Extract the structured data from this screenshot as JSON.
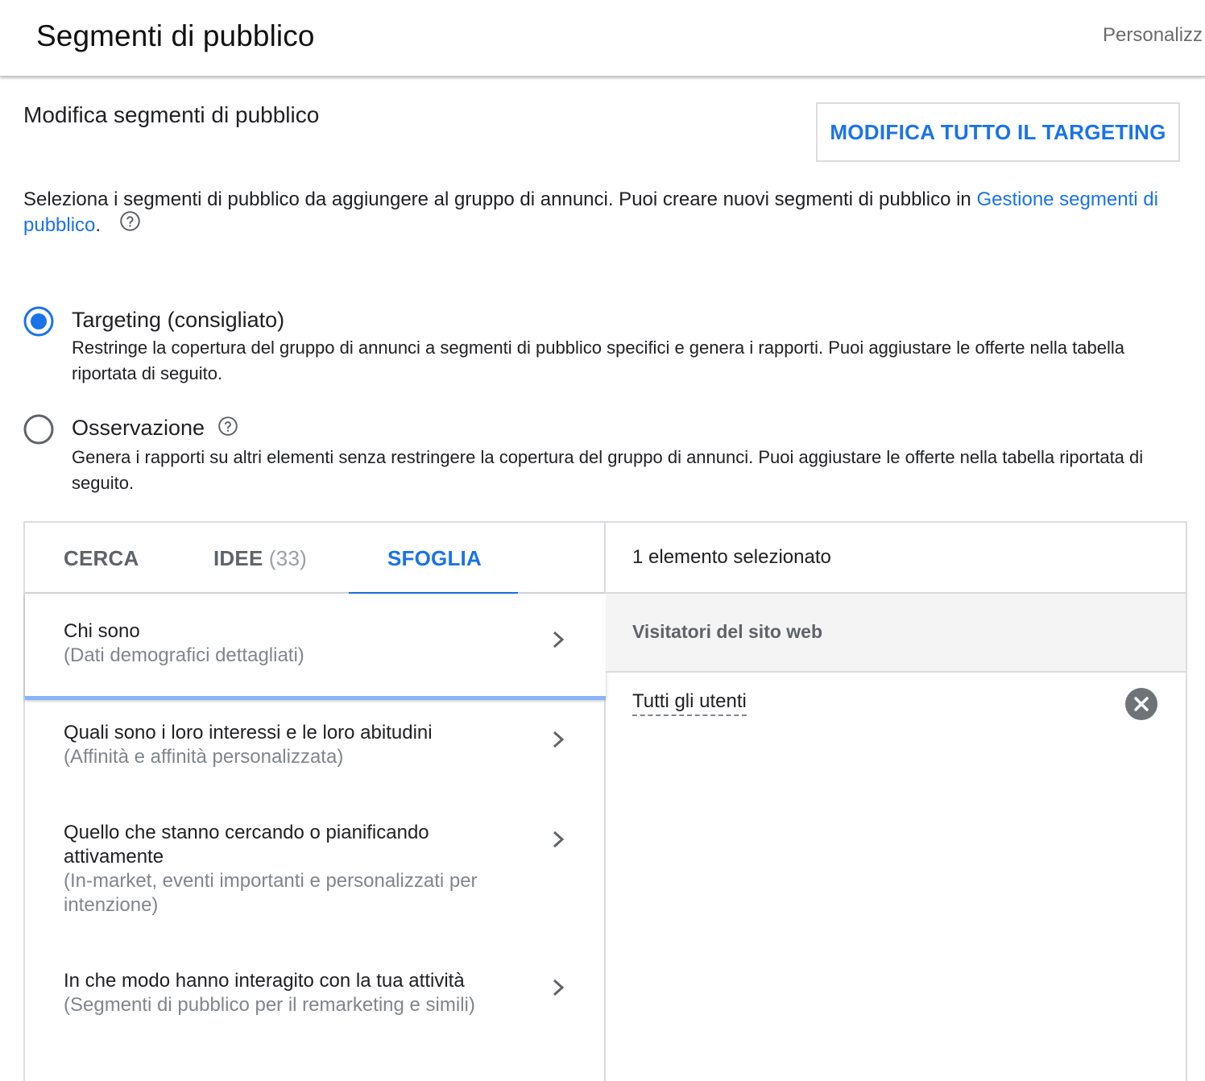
{
  "header": {
    "title": "Segmenti di pubblico",
    "personalize": "Personalizz"
  },
  "section": {
    "title": "Modifica segmenti di pubblico",
    "edit_all_button": "MODIFICA TUTTO IL TARGETING"
  },
  "description": {
    "text": "Seleziona i segmenti di pubblico da aggiungere al gruppo di annunci. Puoi creare nuovi segmenti di pubblico in ",
    "link": "Gestione segmenti di pubblico",
    "after_link": "."
  },
  "radios": [
    {
      "label": "Targeting (consigliato)",
      "description": "Restringe la copertura del gruppo di annunci a segmenti di pubblico specifici e genera i rapporti. Puoi aggiustare le offerte nella tabella riportata di seguito.",
      "selected": true
    },
    {
      "label": "Osservazione",
      "description": "Genera i rapporti su altri elementi senza restringere la copertura del gruppo di annunci. Puoi aggiustare le offerte nella tabella riportata di seguito.",
      "selected": false
    }
  ],
  "tabs": [
    {
      "label": "CERCA"
    },
    {
      "label": "IDEE",
      "count": "(33)"
    },
    {
      "label": "SFOGLIA",
      "active": true
    }
  ],
  "browse_items": [
    {
      "title": "Chi sono",
      "subtitle": "(Dati demografici dettagliati)"
    },
    {
      "title": "Quali sono i loro interessi e le loro abitudini",
      "subtitle": "(Affinità e affinità personalizzata)"
    },
    {
      "title": "Quello che stanno cercando o pianificando attivamente",
      "subtitle": "(In-market, eventi importanti e personalizzati per intenzione)"
    },
    {
      "title": "In che modo hanno interagito con la tua attività",
      "subtitle": "(Segmenti di pubblico per il remarketing e simili)"
    }
  ],
  "selection": {
    "count_label": "1 elemento selezionato",
    "group": "Visitatori del sito web",
    "items": [
      "Tutti gli utenti"
    ]
  },
  "colors": {
    "accent": "#1a73e8",
    "text": "#202124",
    "muted": "#5f6368"
  },
  "icons": [
    "help-icon",
    "radio-selected-icon",
    "radio-unselected-icon",
    "chevron-right-icon",
    "remove-icon"
  ]
}
